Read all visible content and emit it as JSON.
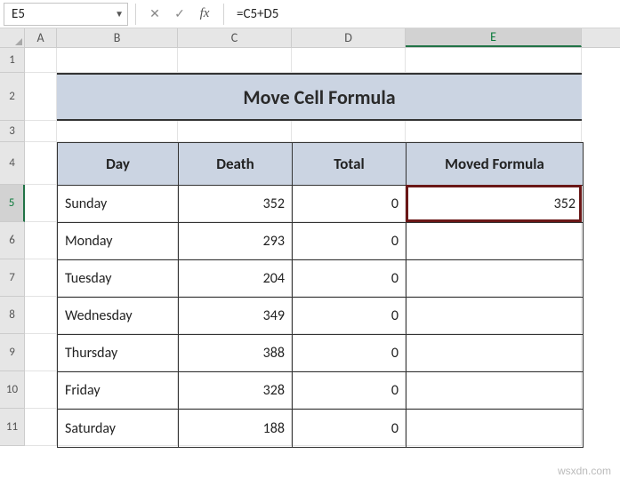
{
  "name_box": "E5",
  "formula": "=C5+D5",
  "columns": [
    "A",
    "B",
    "C",
    "D",
    "E"
  ],
  "active_col": "E",
  "row_labels": [
    "1",
    "2",
    "3",
    "4",
    "5",
    "6",
    "7",
    "8",
    "9",
    "10",
    "11"
  ],
  "active_row": "5",
  "title": "Move Cell Formula",
  "headers": {
    "day": "Day",
    "death": "Death",
    "total": "Total",
    "moved": "Moved Formula"
  },
  "rows": [
    {
      "day": "Sunday",
      "death": "352",
      "total": "0",
      "moved": "352"
    },
    {
      "day": "Monday",
      "death": "293",
      "total": "0",
      "moved": ""
    },
    {
      "day": "Tuesday",
      "death": "204",
      "total": "0",
      "moved": ""
    },
    {
      "day": "Wednesday",
      "death": "349",
      "total": "0",
      "moved": ""
    },
    {
      "day": "Thursday",
      "death": "388",
      "total": "0",
      "moved": ""
    },
    {
      "day": "Friday",
      "death": "328",
      "total": "0",
      "moved": ""
    },
    {
      "day": "Saturday",
      "death": "188",
      "total": "0",
      "moved": ""
    }
  ],
  "icons": {
    "cancel": "✕",
    "enter": "✓",
    "fx": "fx",
    "dropdown": "▼"
  },
  "watermark": "wsxdn.com",
  "chart_data": {
    "type": "table",
    "title": "Move Cell Formula",
    "columns": [
      "Day",
      "Death",
      "Total",
      "Moved Formula"
    ],
    "data": [
      [
        "Sunday",
        352,
        0,
        352
      ],
      [
        "Monday",
        293,
        0,
        null
      ],
      [
        "Tuesday",
        204,
        0,
        null
      ],
      [
        "Wednesday",
        349,
        0,
        null
      ],
      [
        "Thursday",
        388,
        0,
        null
      ],
      [
        "Friday",
        328,
        0,
        null
      ],
      [
        "Saturday",
        188,
        0,
        null
      ]
    ]
  }
}
